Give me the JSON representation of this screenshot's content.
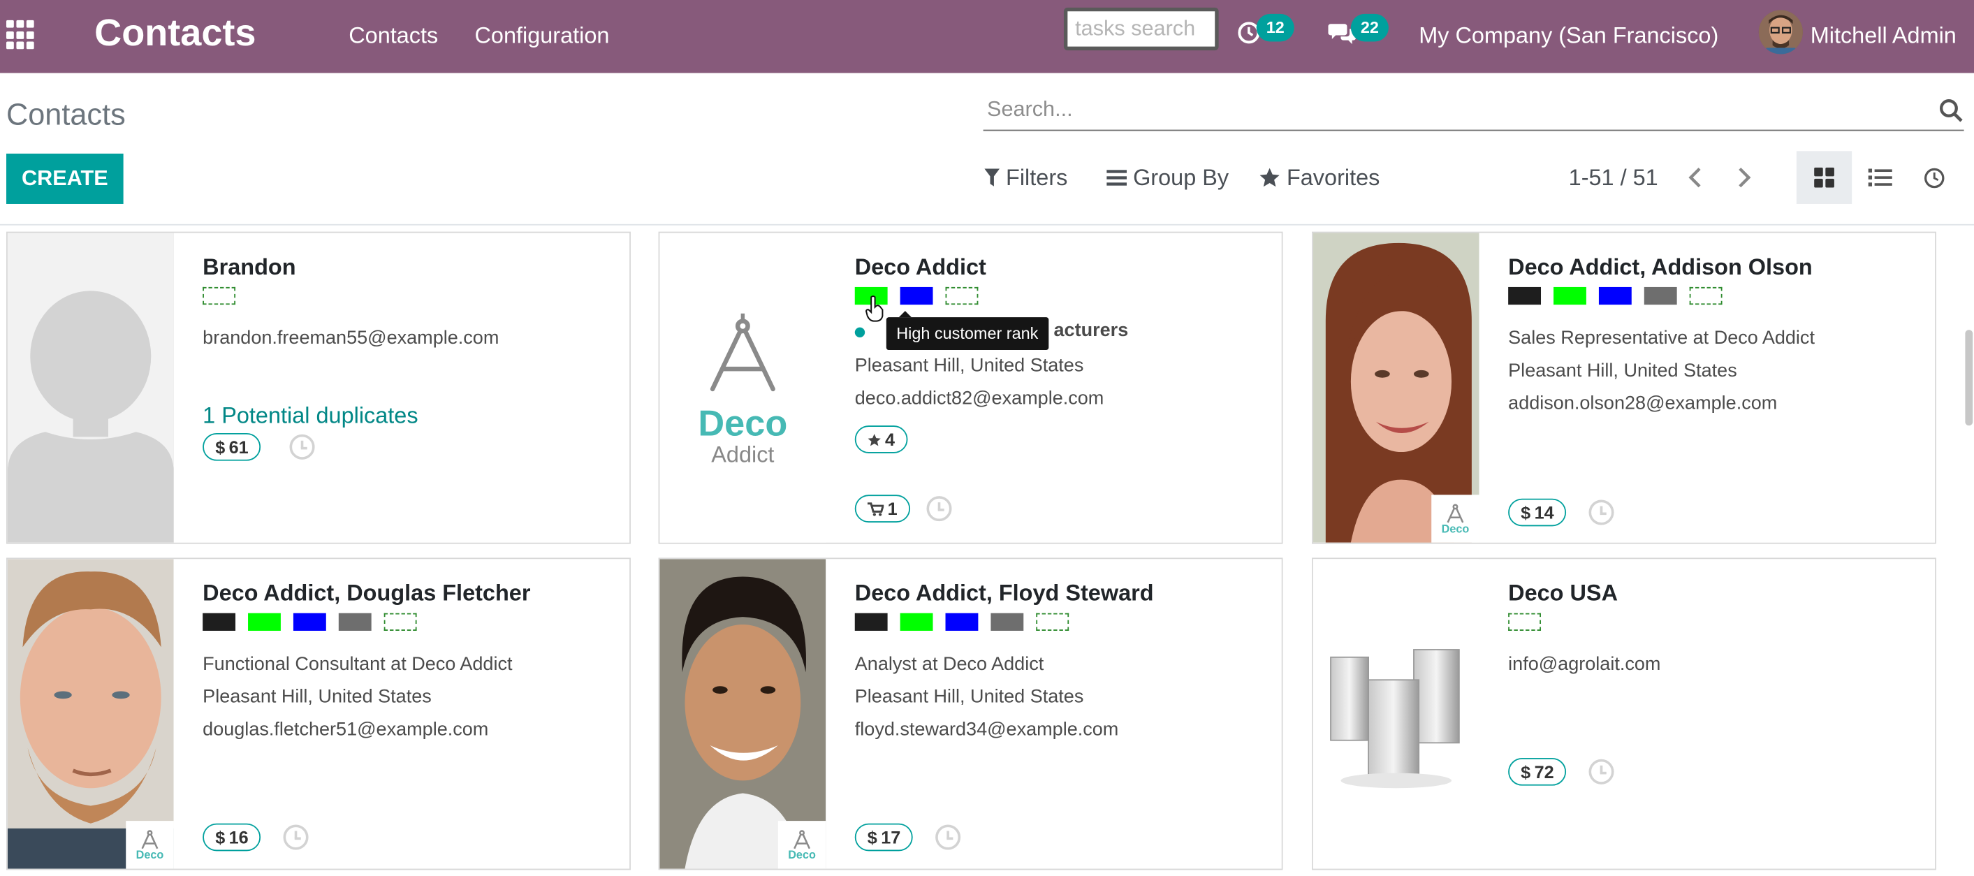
{
  "navbar": {
    "brand": "Contacts",
    "menu": [
      "Contacts",
      "Configuration"
    ],
    "tasks_placeholder": "tasks search",
    "activity_count": "12",
    "message_count": "22",
    "company": "My Company (San Francisco)",
    "user": "Mitchell Admin"
  },
  "control_panel": {
    "title": "Contacts",
    "search_placeholder": "Search...",
    "create_label": "CREATE",
    "filters_label": "Filters",
    "groupby_label": "Group By",
    "favorites_label": "Favorites",
    "pager": "1-51 / 51"
  },
  "tooltip": "High customer rank",
  "colors": {
    "brand": "#875a7b",
    "accent": "#00a09d",
    "tag_black": "#1e1e1e",
    "tag_green": "#00ff00",
    "tag_blue": "#0000ff",
    "tag_gray": "#6e6e6e"
  },
  "cards": [
    {
      "name": "Brandon",
      "email": "brandon.freeman55@example.com",
      "duplicates": "1 Potential duplicates",
      "amount": "61",
      "image": "placeholder-person"
    },
    {
      "name": "Deco Addict",
      "category_fragment": "acturers",
      "location": "Pleasant Hill, United States",
      "email": "deco.addict82@example.com",
      "rank": "4",
      "orders": "1",
      "image": "deco-addict-logo",
      "logo_text": "Deco",
      "logo_subtext": "Addict"
    },
    {
      "name": "Deco Addict, Addison Olson",
      "job": "Sales Representative at Deco Addict",
      "location": "Pleasant Hill, United States",
      "email": "addison.olson28@example.com",
      "amount": "14",
      "image": "photo-woman"
    },
    {
      "name": "Deco Addict, Douglas Fletcher",
      "job": "Functional Consultant at Deco Addict",
      "location": "Pleasant Hill, United States",
      "email": "douglas.fletcher51@example.com",
      "amount": "16",
      "image": "photo-man-beard"
    },
    {
      "name": "Deco Addict, Floyd Steward",
      "job": "Analyst at Deco Addict",
      "location": "Pleasant Hill, United States",
      "email": "floyd.steward34@example.com",
      "amount": "17",
      "image": "photo-man-smiling"
    },
    {
      "name": "Deco USA",
      "email": "info@agrolait.com",
      "amount": "72",
      "image": "company-buildings"
    }
  ]
}
